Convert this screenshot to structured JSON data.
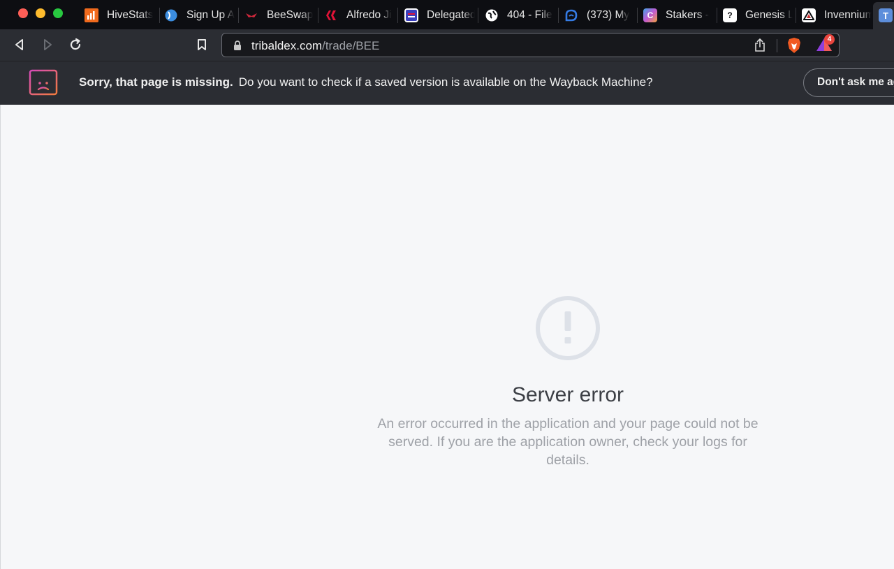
{
  "tabs": [
    {
      "title": "HiveStats",
      "icon": "hivestats-icon",
      "color": "#f06a1d"
    },
    {
      "title": "Sign Up A",
      "icon": "globe-blue-icon",
      "color": "#3b8de0"
    },
    {
      "title": "BeeSwap",
      "icon": "beeswap-icon",
      "color": "#d2283c"
    },
    {
      "title": "Alfredo Ji",
      "icon": "hive-icon",
      "color": "#e31337"
    },
    {
      "title": "Delegated",
      "icon": "delegated-icon",
      "color": "#3a3fbd"
    },
    {
      "title": "404 - File",
      "icon": "globe-icon",
      "color": "#ffffff"
    },
    {
      "title": "(373) My",
      "icon": "ecency-icon",
      "color": "#357ce6"
    },
    {
      "title": "Stakers -",
      "icon": "stakers-icon",
      "color": "#3fa6e8"
    },
    {
      "title": "Genesis L",
      "icon": "genesis-icon",
      "color": "#ffffff"
    },
    {
      "title": "Invennium",
      "icon": "invennium-icon",
      "color": "#ffffff"
    }
  ],
  "active_tab": {
    "icon": "tribaldex-icon",
    "letter": "T"
  },
  "toolbar": {
    "url_host": "tribaldex.com",
    "url_path": "/trade/BEE",
    "rewards_badge": "4"
  },
  "infobar": {
    "bold_text": "Sorry, that page is missing.",
    "text": "Do you want to check if a saved version is available on the Wayback Machine?",
    "button_label": "Don't ask me again"
  },
  "error": {
    "title": "Server error",
    "message": "An error occurred in the application and your page could not be served. If you are the application owner, check your logs for details."
  }
}
